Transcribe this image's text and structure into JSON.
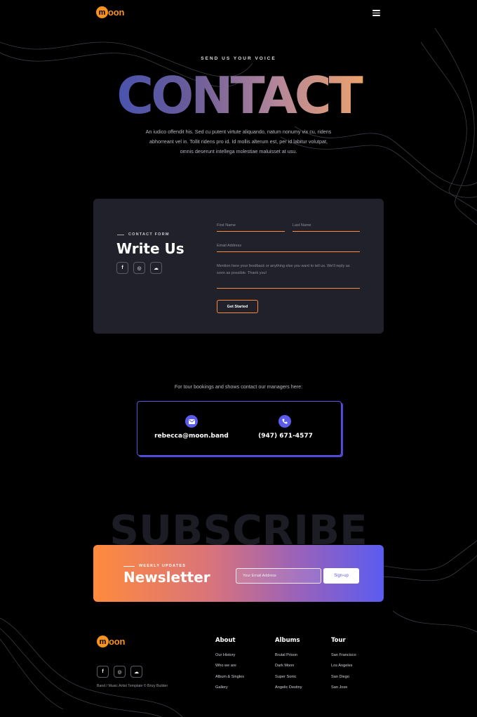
{
  "header": {
    "logo_letter": "m",
    "logo_text": "oon",
    "menu_icon": "hamburger-icon"
  },
  "hero": {
    "eyebrow": "SEND US YOUR VOICE",
    "title": "CONTACT",
    "description_line1": "An iudico offendit his. Sed cu putent virtute aliquando, natum nonumy vix cu, ridens",
    "description_line2": "abhorreant vel in. Tollit ridens pro id. Id mollis alterum est, per id labitur volutpat,",
    "description_line3": "omnis deserunt intellega molestiae maluisset at usu."
  },
  "contact_form": {
    "eyebrow": "CONTACT FORM",
    "heading": "Write Us",
    "social": [
      {
        "icon": "facebook-icon",
        "glyph": "f"
      },
      {
        "icon": "instagram-icon",
        "glyph": "◎"
      },
      {
        "icon": "soundcloud-icon",
        "glyph": "☁"
      }
    ],
    "first_name_placeholder": "First Name",
    "last_name_placeholder": "Last Name",
    "email_placeholder": "Email Address",
    "message_placeholder_line1": "Mention here your feedback or anything else you want to tell us. We'll reply as",
    "message_placeholder_line2": "soon as possible. Thank you!",
    "submit_label": "Get Started"
  },
  "bookings": {
    "intro": "For tour bookings and shows contact our managers here:",
    "email": "rebecca@moon.band",
    "phone": "(947) 671-4577"
  },
  "subscribe": {
    "background_word": "SUBSCRIBE",
    "eyebrow": "WEEKLY UPDATES",
    "title": "Newsletter",
    "email_placeholder": "Your Email Address",
    "button_label": "Sign-up"
  },
  "footer": {
    "logo_letter": "m",
    "logo_text": "oon",
    "copyright": "Band / Music Artist Template © Brizy Builder",
    "columns": [
      {
        "heading": "About",
        "links": [
          "Our History",
          "Who we are",
          "Album & Singles",
          "Gallery"
        ]
      },
      {
        "heading": "Albums",
        "links": [
          "Brutal Prison",
          "Dark Moon",
          "Super Sonic",
          "Angelic Destiny"
        ]
      },
      {
        "heading": "Tour",
        "links": [
          "San Francisco",
          "Los Angeles",
          "San Diego",
          "San Jose"
        ]
      }
    ]
  },
  "colors": {
    "accent_orange": "#ff8a3c",
    "accent_purple": "#5b5bee",
    "card_bg": "#20212b"
  }
}
